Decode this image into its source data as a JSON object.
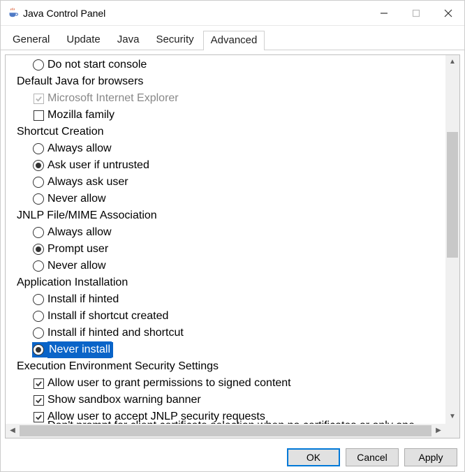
{
  "window": {
    "title": "Java Control Panel"
  },
  "tabs": [
    "General",
    "Update",
    "Java",
    "Security",
    "Advanced"
  ],
  "active_tab": "Advanced",
  "buttons": {
    "ok": "OK",
    "cancel": "Cancel",
    "apply": "Apply"
  },
  "tree": {
    "console": {
      "opt_no_start": "Do not start console"
    },
    "default_java": {
      "label": "Default Java for browsers",
      "ie": "Microsoft Internet Explorer",
      "mozilla": "Mozilla family"
    },
    "shortcut": {
      "label": "Shortcut Creation",
      "always": "Always allow",
      "ask_untrusted": "Ask user if untrusted",
      "always_ask": "Always ask user",
      "never": "Never allow"
    },
    "jnlp": {
      "label": "JNLP File/MIME Association",
      "always": "Always allow",
      "prompt": "Prompt user",
      "never": "Never allow"
    },
    "install": {
      "label": "Application Installation",
      "hinted": "Install if hinted",
      "shortcut": "Install if shortcut created",
      "both": "Install if hinted and shortcut",
      "never": "Never install"
    },
    "exec_env": {
      "label": "Execution Environment Security Settings",
      "grant": "Allow user to grant permissions to signed content",
      "sandbox": "Show sandbox warning banner",
      "jnlpsec": "Allow user to accept JNLP security requests",
      "cert": "Don't prompt for client certificate selection when no certificates or only one exists"
    }
  }
}
